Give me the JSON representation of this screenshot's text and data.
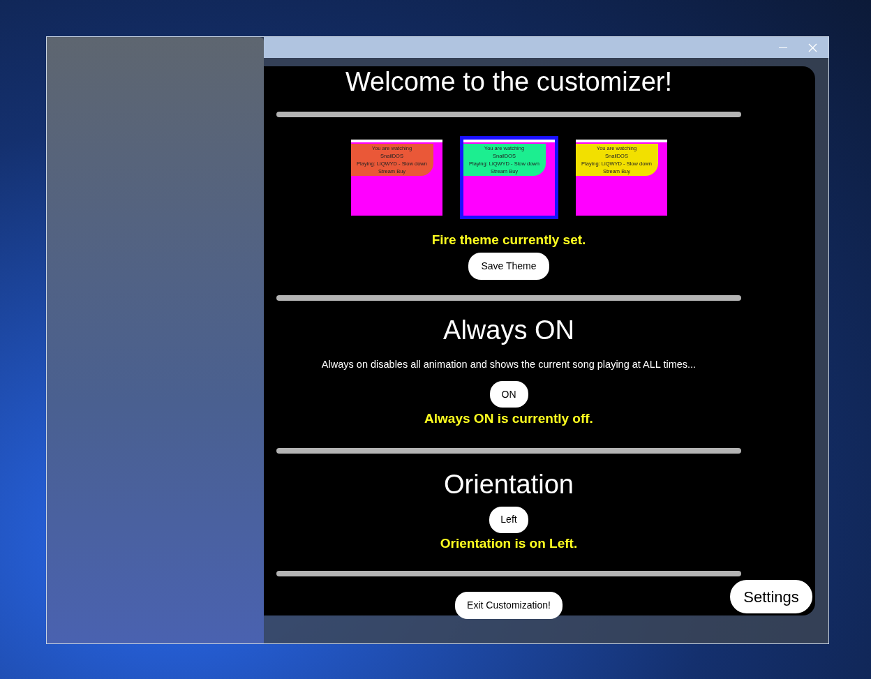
{
  "title": "Welcome to the customizer!",
  "themes": [
    {
      "selected": false,
      "color": "#ea5838",
      "lines": [
        "You are watching",
        "SnailDOS",
        "Playing: LiQWYD - Slow down",
        "Stream Buy"
      ]
    },
    {
      "selected": true,
      "color": "#1cee90",
      "lines": [
        "You are watching",
        "SnailDOS",
        "Playing: LiQWYD - Slow down",
        "Stream Buy"
      ]
    },
    {
      "selected": false,
      "color": "#f2e000",
      "lines": [
        "You are watching",
        "SnailDOS",
        "Playing: LiQWYD - Slow down",
        "Stream Buy"
      ]
    }
  ],
  "theme_status": "Fire theme currently set.",
  "save_button": "Save Theme",
  "always_on": {
    "heading": "Always ON",
    "description": "Always on disables all animation and shows the current song playing at ALL times...",
    "button": "ON",
    "status": "Always ON is currently off."
  },
  "orientation": {
    "heading": "Orientation",
    "button": "Left",
    "status": "Orientation is on Left."
  },
  "exit_button": "Exit Customization!",
  "settings_button": "Settings"
}
